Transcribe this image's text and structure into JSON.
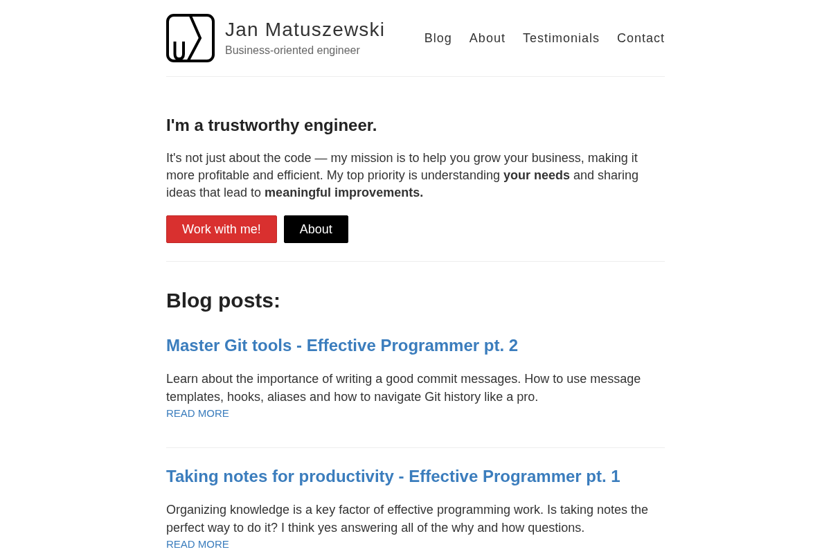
{
  "header": {
    "name": "Jan Matuszewski",
    "tagline": "Business-oriented engineer",
    "nav": [
      {
        "label": "Blog"
      },
      {
        "label": "About"
      },
      {
        "label": "Testimonials"
      },
      {
        "label": "Contact"
      }
    ]
  },
  "hero": {
    "heading": "I'm a trustworthy engineer.",
    "text": "It's not just about the code — my mission is to help you grow your business, making it more profitable and efficient. My top priority is understanding **your needs** and sharing ideas that lead to **meaningful improvements.**",
    "buttons": [
      {
        "label": "Work with me!",
        "kind": "primary"
      },
      {
        "label": "About",
        "kind": "dark"
      }
    ]
  },
  "blog": {
    "heading": "Blog posts:",
    "posts": [
      {
        "title": "Master Git tools - Effective Programmer pt. 2",
        "excerpt": "Learn about the importance of writing a good commit messages. How to use message templates, hooks, aliases and how to navigate Git history like a pro.",
        "link": "READ MORE"
      },
      {
        "title": "Taking notes for productivity - Effective Programmer pt. 1",
        "excerpt": "Organizing knowledge is a key factor of effective programming work. Is taking notes the perfect way to do it? I think yes answering all of the why and how questions.",
        "link": "READ MORE"
      }
    ]
  }
}
